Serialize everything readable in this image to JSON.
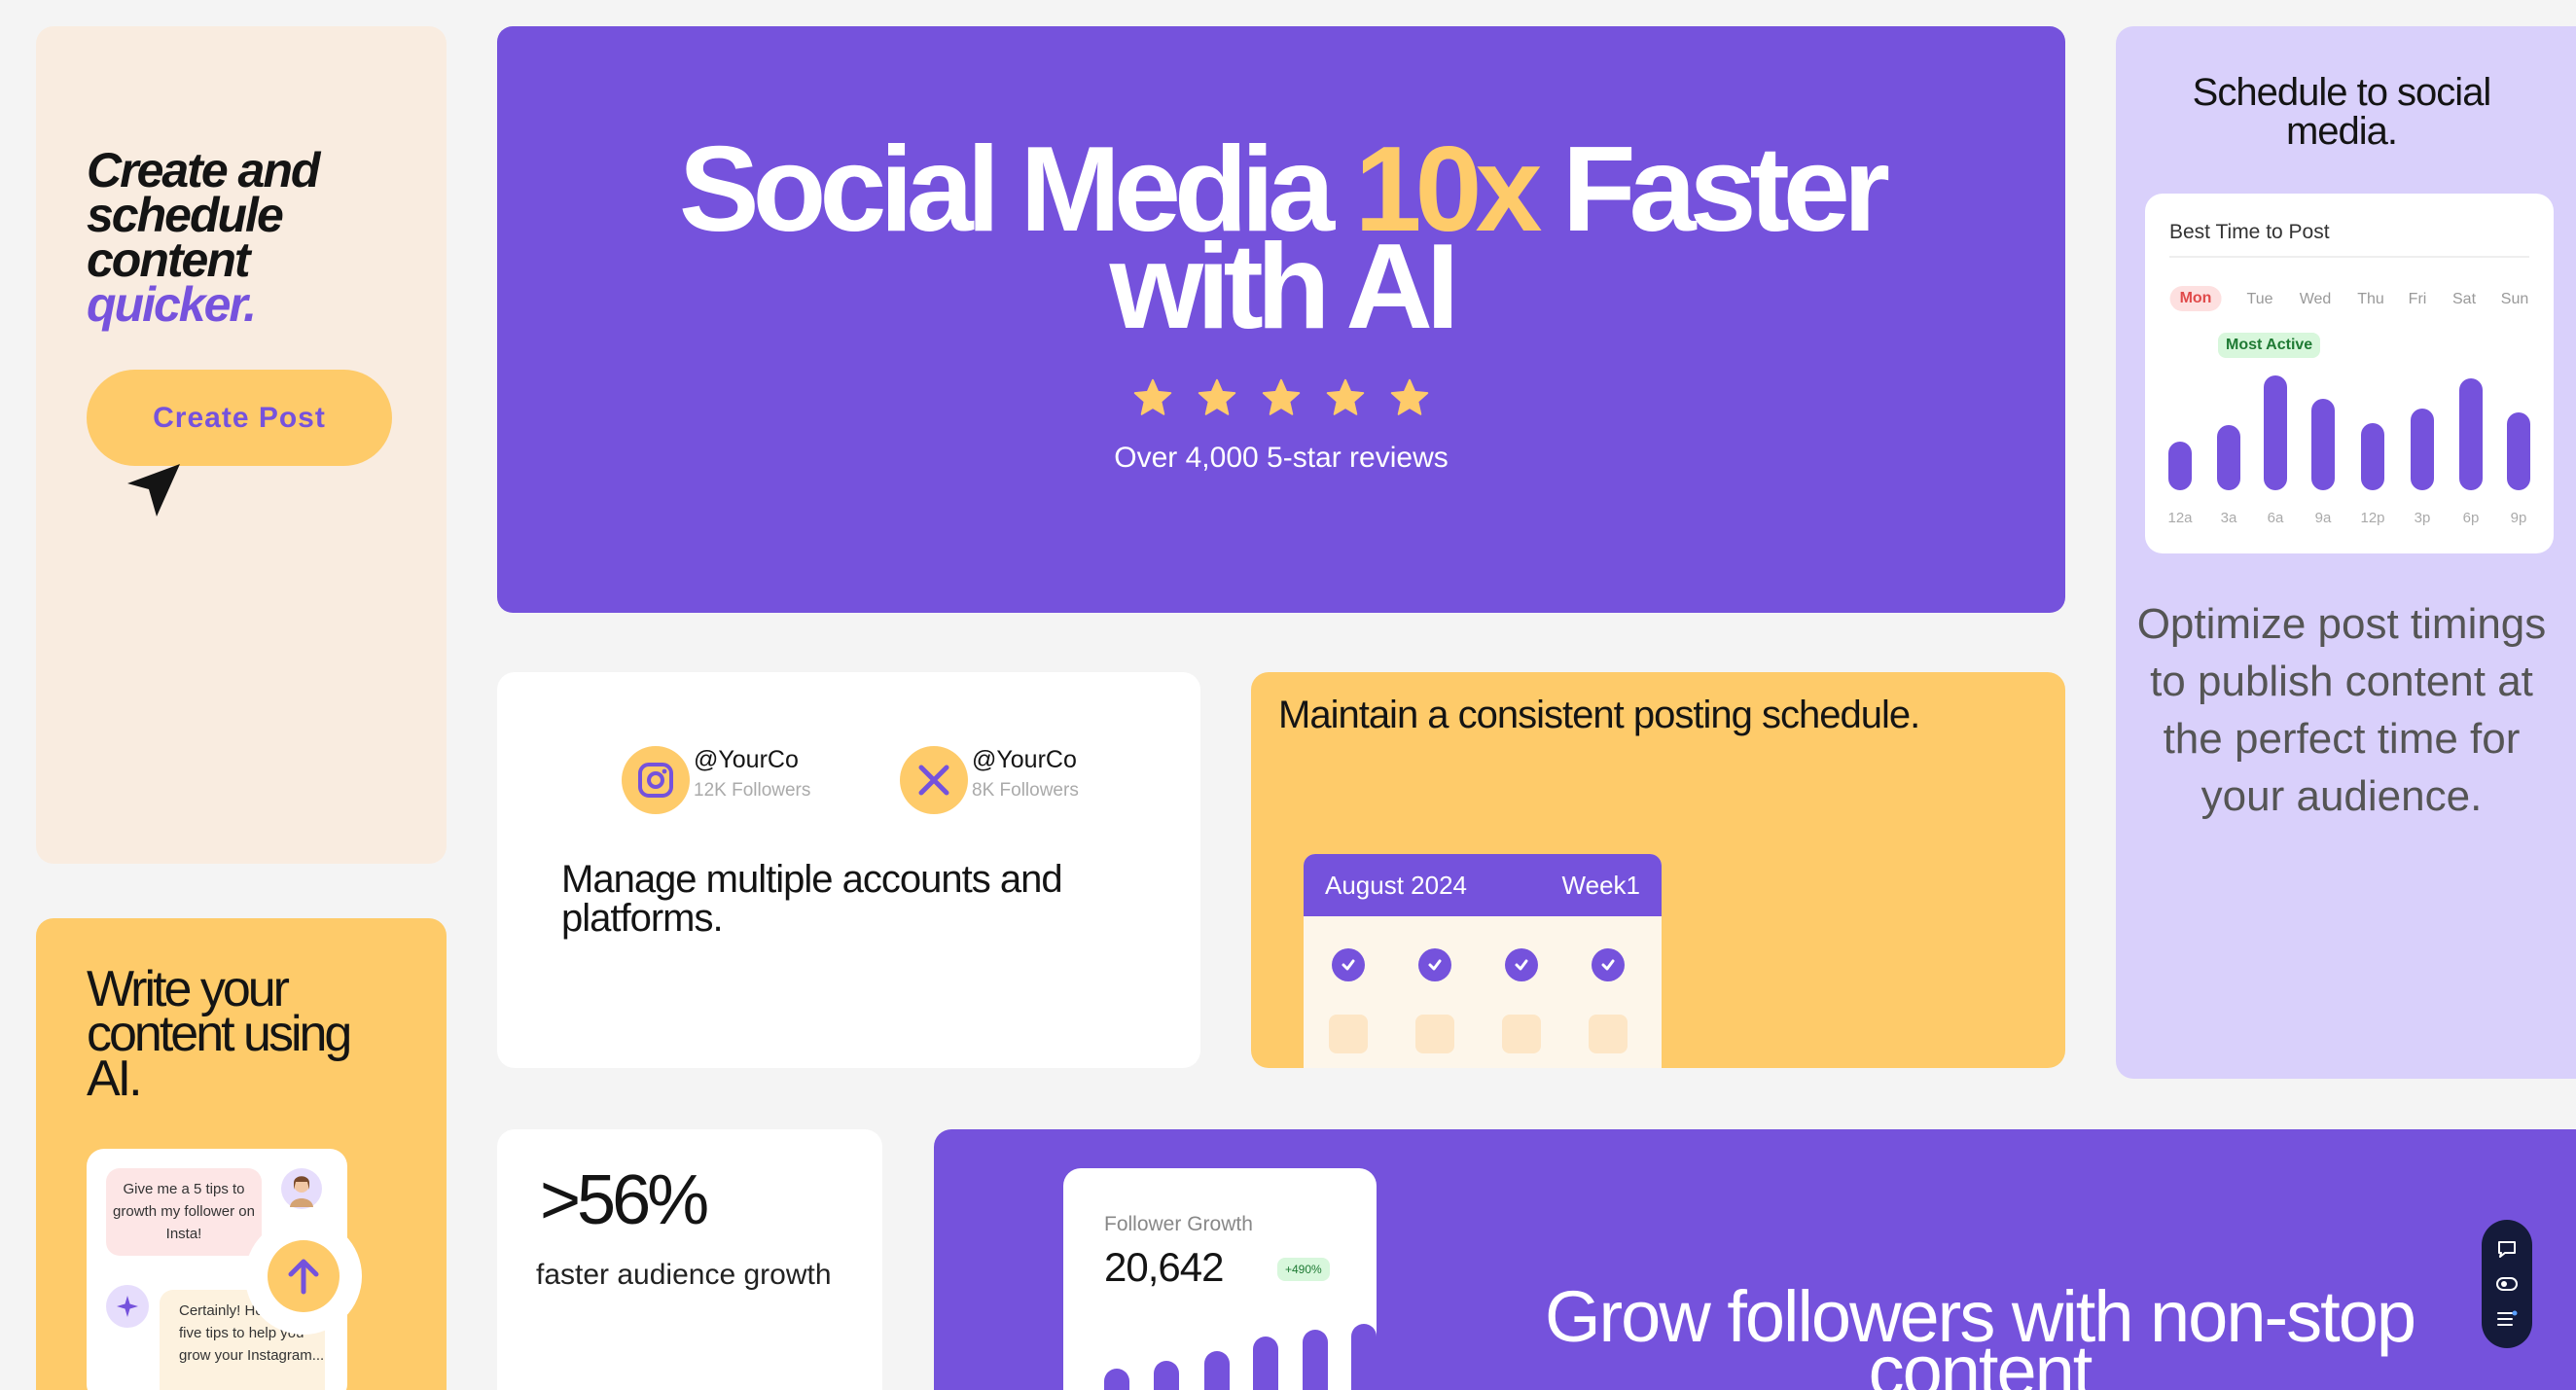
{
  "hero": {
    "title_line1_a": "Social Media ",
    "title_accent": "10x",
    "title_line1_b": " Faster",
    "title_line2": "with AI",
    "rating_stars": 5,
    "reviews": "Over 4,000 5-star reviews"
  },
  "create_card": {
    "line1": "Create and",
    "line2": "schedule",
    "line3": "content",
    "highlight": "quicker.",
    "button": "Create Post"
  },
  "schedule_card": {
    "title_line1": "Schedule to social",
    "title_line2": "media.",
    "panel_title": "Best Time to Post",
    "days": [
      "Mon",
      "Tue",
      "Wed",
      "Thu",
      "Fri",
      "Sat",
      "Sun"
    ],
    "active_day": "Mon",
    "badge": "Most Active",
    "times": [
      "12a",
      "3a",
      "6a",
      "9a",
      "12p",
      "3p",
      "6p",
      "9p"
    ],
    "activity": [
      30,
      42,
      80,
      62,
      44,
      55,
      78,
      52
    ],
    "description": "Optimize post timings to publish content at the perfect time for your audience."
  },
  "accounts_card": {
    "accounts": [
      {
        "handle": "@YourCo",
        "followers": "12K Followers",
        "platform": "instagram-icon"
      },
      {
        "handle": "@YourCo",
        "followers": "8K Followers",
        "platform": "x-icon"
      }
    ],
    "text": "Manage multiple accounts and platforms."
  },
  "posting_card": {
    "title": "Maintain a consistent posting schedule.",
    "month": "August 2024",
    "week": "Week1"
  },
  "write_card": {
    "title": "Write your content using AI.",
    "user_message": "Give me a 5 tips to growth my follower on Insta!",
    "ai_message": "Certainly! Here are five tips to help you grow your Instagram..."
  },
  "stat_card": {
    "value": ">56%",
    "label": "faster audience growth"
  },
  "grow_card": {
    "panel_title": "Follower Growth",
    "count": "20,642",
    "change": "+490%",
    "growth_bars": [
      22,
      30,
      40,
      55,
      62,
      68
    ],
    "title": "Grow followers with non-stop content"
  },
  "colors": {
    "purple": "#7552dc",
    "yellow": "#fecb6a",
    "cream": "#f9ece0",
    "lavender": "#d9d0fb"
  }
}
